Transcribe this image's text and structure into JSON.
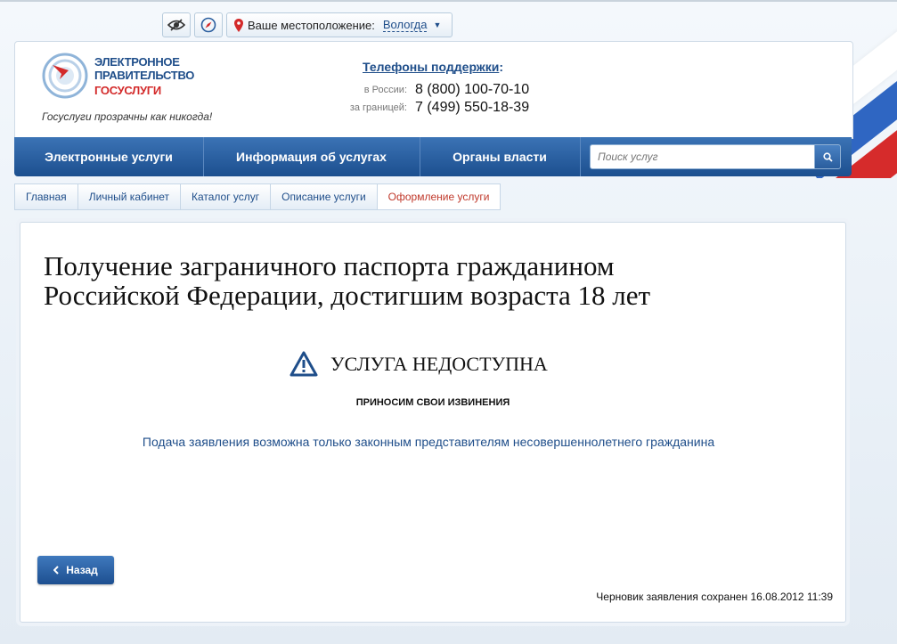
{
  "util": {
    "location_label": "Ваше местоположение:",
    "location_city": "Вологда",
    "icons": [
      "low-vision-icon",
      "compass-icon",
      "map-pin-icon"
    ]
  },
  "header": {
    "logo_line1": "ЭЛЕКТРОННОЕ",
    "logo_line2": "ПРАВИТЕЛЬСТВО",
    "logo_line3": "ГОСУСЛУГИ",
    "slogan": "Госуслуги прозрачны как никогда!",
    "support_title": "Телефоны поддержки",
    "support_colon": ":",
    "phones": [
      {
        "label": "в России:",
        "number": "8 (800) 100-70-10"
      },
      {
        "label": "за границей:",
        "number": "7 (499) 550-18-39"
      }
    ]
  },
  "nav": {
    "items": [
      "Электронные услуги",
      "Информация об услугах",
      "Органы власти"
    ],
    "search_placeholder": "Поиск услуг"
  },
  "breadcrumbs": [
    "Главная",
    "Личный кабинет",
    "Каталог услуг",
    "Описание услуги",
    "Оформление услуги"
  ],
  "main": {
    "title": "Получение заграничного паспорта гражданином Российской Федерации, достигшим возраста 18 лет",
    "status": "УСЛУГА НЕДОСТУПНА",
    "apology": "ПРИНОСИМ СВОИ ИЗВИНЕНИЯ",
    "message": "Подача заявления возможна только законным представителям несовершеннолетнего гражданина",
    "back_label": "Назад",
    "draft_status": "Черновик заявления сохранен 16.08.2012 11:39"
  },
  "colors": {
    "brand_blue": "#1f4e8a",
    "brand_red": "#d32a2a",
    "nav_gradient_top": "#3b73b5",
    "nav_gradient_bottom": "#1c4f8f"
  }
}
